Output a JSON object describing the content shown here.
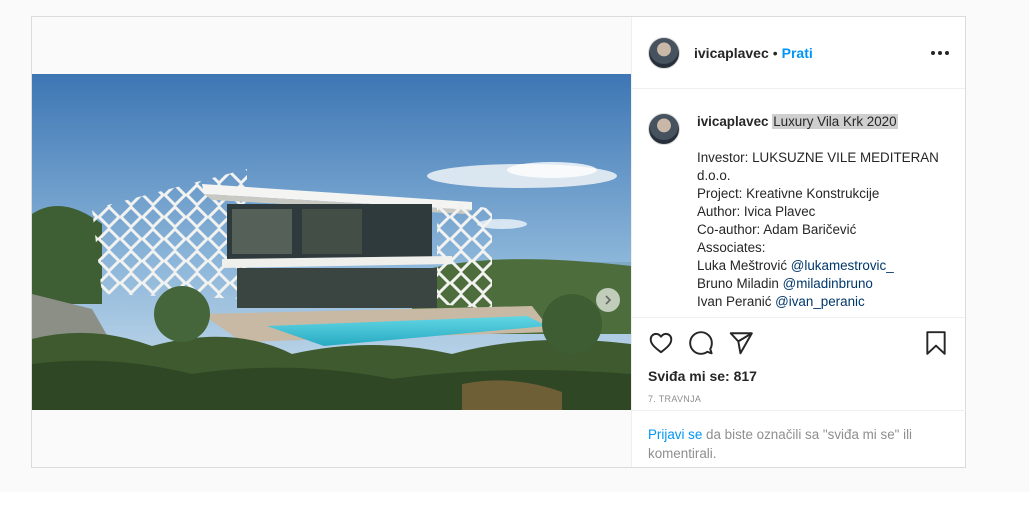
{
  "post": {
    "username": "ivicaplavec",
    "separator": "•",
    "follow_label": "Prati",
    "more_icon": "more-options-icon"
  },
  "caption": {
    "username": "ivicaplavec",
    "title": "Luxury Vila Krk 2020",
    "lines": [
      "Investor: LUKSUZNE VILE MEDITERAN",
      "d.o.o.",
      "Project: Kreativne Konstrukcije",
      "Author: Ivica Plavec",
      "Co-author: Adam Baričević",
      "Associates:"
    ],
    "associates": [
      {
        "name": "Luka Meštrović",
        "handle": "@lukamestrovic_"
      },
      {
        "name": "Bruno Miladin",
        "handle": "@miladinbruno"
      },
      {
        "name": "Ivan Peranić",
        "handle": "@ivan_peranic"
      }
    ]
  },
  "actions": {
    "like_icon": "heart-icon",
    "comment_icon": "comment-icon",
    "share_icon": "share-icon",
    "save_icon": "bookmark-icon"
  },
  "likes_text": "Sviđa mi se: 817",
  "date_text": "7. TRAVNJA",
  "login": {
    "link": "Prijavi se",
    "rest": " da biste označili sa \"sviđa mi se\" ili komentirali."
  },
  "carousel": {
    "total": 5,
    "active_index": 0,
    "next_icon": "chevron-right-icon"
  },
  "colors": {
    "accent": "#0095f6",
    "mention": "#00376b",
    "pool": "#3fc6d8",
    "sky_top": "#3e78b6"
  }
}
